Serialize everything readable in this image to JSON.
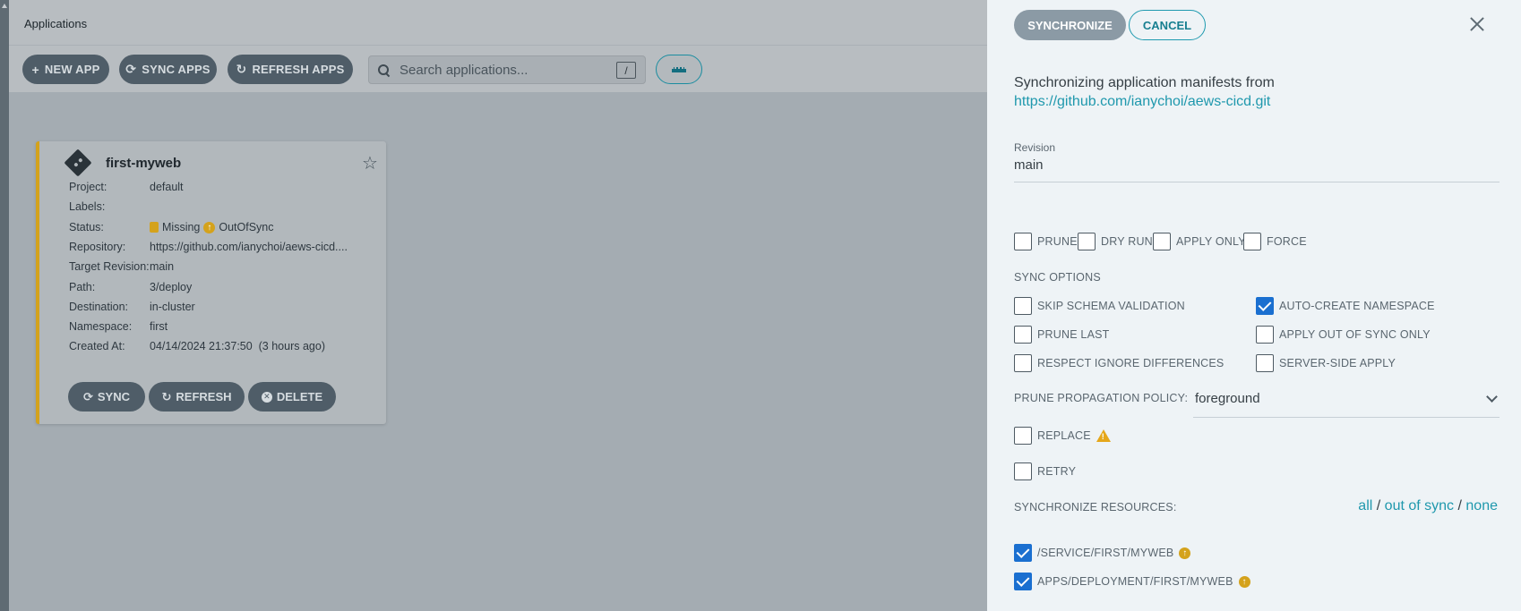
{
  "page": {
    "title": "Applications"
  },
  "toolbar": {
    "new_app": "NEW APP",
    "sync_apps": "SYNC APPS",
    "refresh_apps": "REFRESH APPS",
    "search_placeholder": "Search applications...",
    "search_shortcut": "/"
  },
  "app_card": {
    "name": "first-myweb",
    "rows": [
      {
        "key": "Project:",
        "value": "default"
      },
      {
        "key": "Labels:",
        "value": ""
      },
      {
        "key": "Status:",
        "health": "Missing",
        "sync": "OutOfSync"
      },
      {
        "key": "Repository:",
        "value": "https://github.com/ianychoi/aews-cicd...."
      },
      {
        "key": "Target Revision:",
        "value": "main"
      },
      {
        "key": "Path:",
        "value": "3/deploy"
      },
      {
        "key": "Destination:",
        "value": "in-cluster"
      },
      {
        "key": "Namespace:",
        "value": "first"
      },
      {
        "key": "Created At:",
        "value": "04/14/2024 21:37:50  (3 hours ago)"
      }
    ],
    "actions": {
      "sync": "SYNC",
      "refresh": "REFRESH",
      "delete": "DELETE"
    },
    "status_color": "#d4a21c"
  },
  "panel": {
    "synchronize": "SYNCHRONIZE",
    "cancel": "CANCEL",
    "intro": "Synchronizing application manifests from",
    "repo_url": "https://github.com/ianychoi/aews-cicd.git",
    "revision_label": "Revision",
    "revision_value": "main",
    "flags": [
      {
        "label": "PRUNE",
        "checked": false
      },
      {
        "label": "DRY RUN",
        "checked": false
      },
      {
        "label": "APPLY ONLY",
        "checked": false
      },
      {
        "label": "FORCE",
        "checked": false
      }
    ],
    "sync_options_title": "SYNC OPTIONS",
    "sync_options": [
      {
        "label": "SKIP SCHEMA VALIDATION",
        "checked": false
      },
      {
        "label": "AUTO-CREATE NAMESPACE",
        "checked": true
      },
      {
        "label": "PRUNE LAST",
        "checked": false
      },
      {
        "label": "APPLY OUT OF SYNC ONLY",
        "checked": false
      },
      {
        "label": "RESPECT IGNORE DIFFERENCES",
        "checked": false
      },
      {
        "label": "SERVER-SIDE APPLY",
        "checked": false
      }
    ],
    "prune_policy_label": "PRUNE PROPAGATION POLICY:",
    "prune_policy_value": "foreground",
    "replace_label": "REPLACE",
    "retry_label": "RETRY",
    "resources_label": "SYNCHRONIZE RESOURCES:",
    "resource_filters": {
      "all": "all",
      "out_of_sync": "out of sync",
      "none": "none",
      "sep": "/"
    },
    "resources": [
      {
        "label": "/SERVICE/FIRST/MYWEB",
        "checked": true
      },
      {
        "label": "APPS/DEPLOYMENT/FIRST/MYWEB",
        "checked": true
      }
    ],
    "accent_color": "#1f98ad",
    "check_color": "#1a6fd0"
  }
}
